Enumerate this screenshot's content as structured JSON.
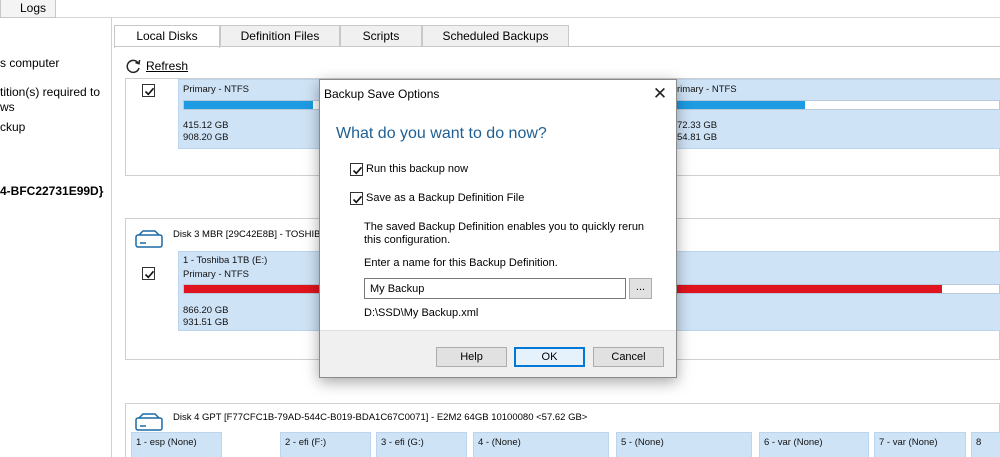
{
  "top": {
    "logs_tab": "Logs"
  },
  "left_pane": {
    "items": [
      "s computer",
      "tition(s) required to",
      "ws",
      "ckup",
      "4-BFC22731E99D}"
    ]
  },
  "tabs": [
    {
      "label": "Local Disks",
      "active": true
    },
    {
      "label": "Definition Files",
      "active": false
    },
    {
      "label": "Scripts",
      "active": false
    },
    {
      "label": "Scheduled Backups",
      "active": false
    }
  ],
  "toolbar": {
    "refresh_label": "Refresh",
    "refresh_icon": "refresh-icon"
  },
  "disks": [
    {
      "title": "",
      "checked": true,
      "partitions": [
        {
          "line1": "Primary - NTFS",
          "used": "415.12 GB",
          "total": "908.20 GB",
          "fill": 0.46,
          "color": "#1e9be2"
        },
        {
          "line1": "rimary - NTFS",
          "used": "72.33 GB",
          "total": "54.81 GB",
          "fill": 0.4,
          "color": "#1e9be2"
        }
      ]
    },
    {
      "title": "Disk 3 MBR [29C42E8B] - TOSHIBA",
      "checked": true,
      "partitions": [
        {
          "line0": "1 - Toshiba 1TB (E:)",
          "line1": "Primary - NTFS",
          "used": "866.20 GB",
          "total": "931.51 GB",
          "fill": 0.93,
          "color": "#e0141e"
        }
      ]
    },
    {
      "title": "Disk 4 GPT [F77CFC1B-79AD-544C-B019-BDA1C67C0071] - E2M2 64GB 10100080  <57.62 GB>",
      "checked": true,
      "partitions": [
        {
          "line0": "1 - esp (None)"
        },
        {
          "line0": "2 - efi (F:)"
        },
        {
          "line0": "3 - efi (G:)"
        },
        {
          "line0": "4 -  (None)"
        },
        {
          "line0": "5 -  (None)"
        },
        {
          "line0": "6 - var (None)"
        },
        {
          "line0": "7 - var (None)"
        },
        {
          "line0": "8"
        }
      ]
    }
  ],
  "dialog": {
    "title": "Backup Save Options",
    "close_glyph": "✕",
    "heading": "What do you want to do now?",
    "run_now_label": "Run this backup now",
    "run_now_checked": true,
    "save_def_label": "Save as a Backup Definition File",
    "save_def_checked": true,
    "description": "The saved Backup Definition enables you to quickly rerun this configuration.",
    "name_label": "Enter a name for this Backup Definition.",
    "name_value": "My Backup",
    "browse_label": "...",
    "path": "D:\\SSD\\My Backup.xml",
    "buttons": {
      "help": "Help",
      "ok": "OK",
      "cancel": "Cancel"
    }
  },
  "colors": {
    "accent": "#1f5f93",
    "partition_bg": "#cfe3f6",
    "bar_blue": "#1e9be2",
    "bar_red": "#e0141e"
  }
}
